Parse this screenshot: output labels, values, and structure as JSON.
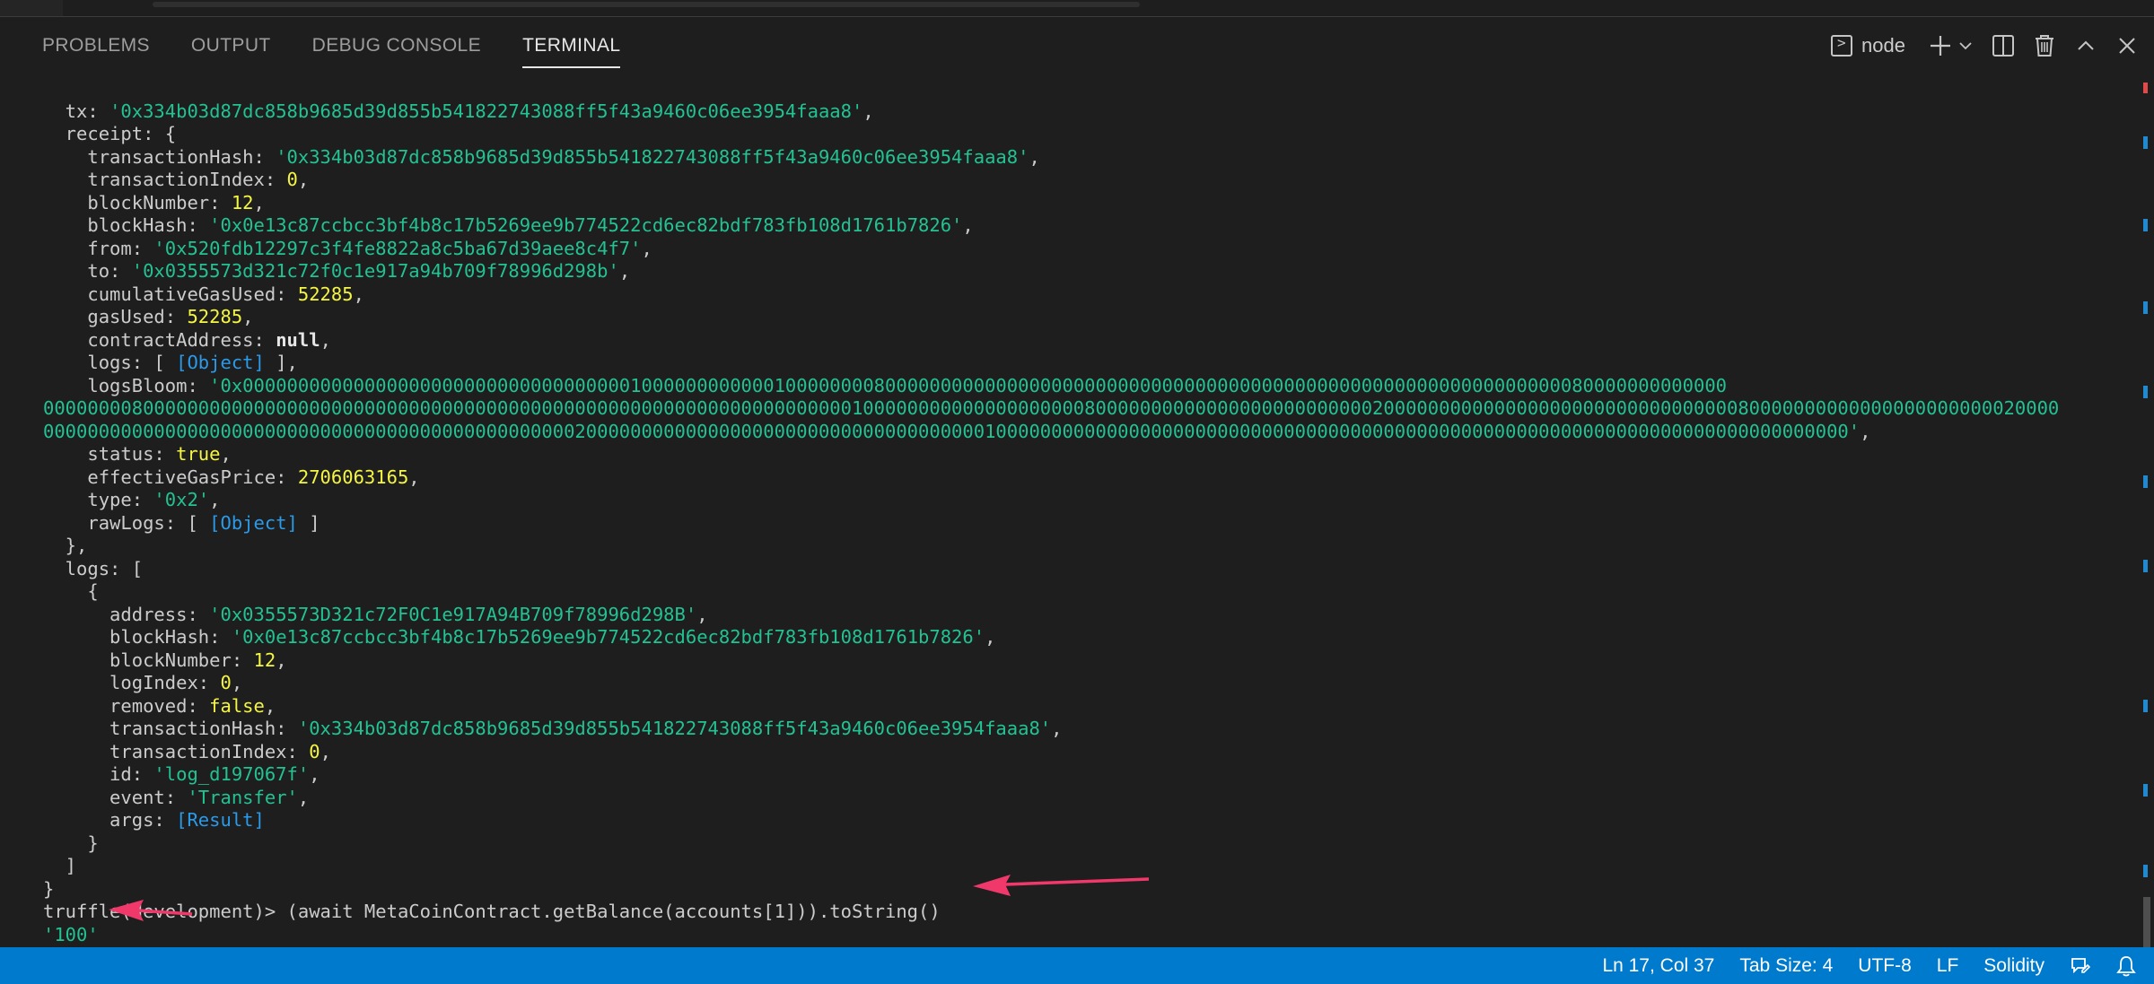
{
  "panel": {
    "tabs": [
      {
        "label": "PROBLEMS"
      },
      {
        "label": "OUTPUT"
      },
      {
        "label": "DEBUG CONSOLE"
      },
      {
        "label": "TERMINAL",
        "active": true
      }
    ],
    "terminal_name": "node",
    "action_icons": [
      "terminal-icon",
      "plus-icon",
      "chevron-down-icon",
      "split-icon",
      "trash-icon",
      "chevron-up-icon",
      "close-icon"
    ]
  },
  "terminal": {
    "lines": [
      [
        [
          "k",
          "  tx: "
        ],
        [
          "s",
          "'0x334b03d87dc858b9685d39d855b541822743088ff5f43a9460c06ee3954faaa8'"
        ],
        [
          "p",
          ","
        ]
      ],
      [
        [
          "k",
          "  receipt: {"
        ]
      ],
      [
        [
          "k",
          "    transactionHash: "
        ],
        [
          "s",
          "'0x334b03d87dc858b9685d39d855b541822743088ff5f43a9460c06ee3954faaa8'"
        ],
        [
          "p",
          ","
        ]
      ],
      [
        [
          "k",
          "    transactionIndex: "
        ],
        [
          "n",
          "0"
        ],
        [
          "p",
          ","
        ]
      ],
      [
        [
          "k",
          "    blockNumber: "
        ],
        [
          "n",
          "12"
        ],
        [
          "p",
          ","
        ]
      ],
      [
        [
          "k",
          "    blockHash: "
        ],
        [
          "s",
          "'0x0e13c87ccbcc3bf4b8c17b5269ee9b774522cd6ec82bdf783fb108d1761b7826'"
        ],
        [
          "p",
          ","
        ]
      ],
      [
        [
          "k",
          "    from: "
        ],
        [
          "s",
          "'0x520fdb12297c3f4fe8822a8c5ba67d39aee8c4f7'"
        ],
        [
          "p",
          ","
        ]
      ],
      [
        [
          "k",
          "    to: "
        ],
        [
          "s",
          "'0x0355573d321c72f0c1e917a94b709f78996d298b'"
        ],
        [
          "p",
          ","
        ]
      ],
      [
        [
          "k",
          "    cumulativeGasUsed: "
        ],
        [
          "n",
          "52285"
        ],
        [
          "p",
          ","
        ]
      ],
      [
        [
          "k",
          "    gasUsed: "
        ],
        [
          "n",
          "52285"
        ],
        [
          "p",
          ","
        ]
      ],
      [
        [
          "k",
          "    contractAddress: "
        ],
        [
          "b",
          "null"
        ],
        [
          "p",
          ","
        ]
      ],
      [
        [
          "k",
          "    logs: [ "
        ],
        [
          "o",
          "[Object]"
        ],
        [
          "k",
          " ],"
        ]
      ],
      [
        [
          "k",
          "    logsBloom: "
        ],
        [
          "s",
          "'0x00000000000000000000000000000000000100000000000010000000080000000000000000000000000000000000000000000000000000000000000080000000000000"
        ]
      ],
      [
        [
          "s",
          "00000000800000000000000000000000000000000000000000000000000000000000000001000000000000000000008000000000000000000000000020000000000000000000000000000000080000000000000000000000020000"
        ]
      ],
      [
        [
          "s",
          "0000000000000000000000000000000000000000000000002000000000000000000000000000000000000100000000000000000000000000000000000000000000000000000000000000000000000000000'"
        ],
        [
          "p",
          ","
        ]
      ],
      [
        [
          "k",
          "    status: "
        ],
        [
          "n",
          "true"
        ],
        [
          "p",
          ","
        ]
      ],
      [
        [
          "k",
          "    effectiveGasPrice: "
        ],
        [
          "n",
          "2706063165"
        ],
        [
          "p",
          ","
        ]
      ],
      [
        [
          "k",
          "    type: "
        ],
        [
          "s",
          "'0x2'"
        ],
        [
          "p",
          ","
        ]
      ],
      [
        [
          "k",
          "    rawLogs: [ "
        ],
        [
          "o",
          "[Object]"
        ],
        [
          "k",
          " ]"
        ]
      ],
      [
        [
          "k",
          "  },"
        ]
      ],
      [
        [
          "k",
          "  logs: ["
        ]
      ],
      [
        [
          "k",
          "    {"
        ]
      ],
      [
        [
          "k",
          "      address: "
        ],
        [
          "s",
          "'0x0355573D321c72F0C1e917A94B709f78996d298B'"
        ],
        [
          "p",
          ","
        ]
      ],
      [
        [
          "k",
          "      blockHash: "
        ],
        [
          "s",
          "'0x0e13c87ccbcc3bf4b8c17b5269ee9b774522cd6ec82bdf783fb108d1761b7826'"
        ],
        [
          "p",
          ","
        ]
      ],
      [
        [
          "k",
          "      blockNumber: "
        ],
        [
          "n",
          "12"
        ],
        [
          "p",
          ","
        ]
      ],
      [
        [
          "k",
          "      logIndex: "
        ],
        [
          "n",
          "0"
        ],
        [
          "p",
          ","
        ]
      ],
      [
        [
          "k",
          "      removed: "
        ],
        [
          "n",
          "false"
        ],
        [
          "p",
          ","
        ]
      ],
      [
        [
          "k",
          "      transactionHash: "
        ],
        [
          "s",
          "'0x334b03d87dc858b9685d39d855b541822743088ff5f43a9460c06ee3954faaa8'"
        ],
        [
          "p",
          ","
        ]
      ],
      [
        [
          "k",
          "      transactionIndex: "
        ],
        [
          "n",
          "0"
        ],
        [
          "p",
          ","
        ]
      ],
      [
        [
          "k",
          "      id: "
        ],
        [
          "s",
          "'log_d197067f'"
        ],
        [
          "p",
          ","
        ]
      ],
      [
        [
          "k",
          "      event: "
        ],
        [
          "s",
          "'Transfer'"
        ],
        [
          "p",
          ","
        ]
      ],
      [
        [
          "k",
          "      args: "
        ],
        [
          "o",
          "[Result]"
        ]
      ],
      [
        [
          "k",
          "    }"
        ]
      ],
      [
        [
          "k",
          "  ]"
        ]
      ],
      [
        [
          "k",
          "}"
        ]
      ],
      [
        [
          "prompt",
          "truffle(development)> "
        ],
        [
          "k",
          "(await MetaCoinContract.getBalance(accounts[1])).toString()"
        ]
      ],
      [
        [
          "s",
          "'100'"
        ]
      ]
    ],
    "prompt": "truffle(development)> "
  },
  "status_bar": {
    "cursor_pos": "Ln 17, Col 37",
    "tab_size": "Tab Size: 4",
    "encoding": "UTF-8",
    "eol": "LF",
    "language": "Solidity",
    "icons": [
      "feedback-icon",
      "bell-icon"
    ]
  },
  "colors": {
    "background": "#1e1e1e",
    "string": "#23c293",
    "number": "#f5f543",
    "object": "#2b9ae8",
    "arrow": "#f0386b",
    "status_bar": "#007acc"
  }
}
